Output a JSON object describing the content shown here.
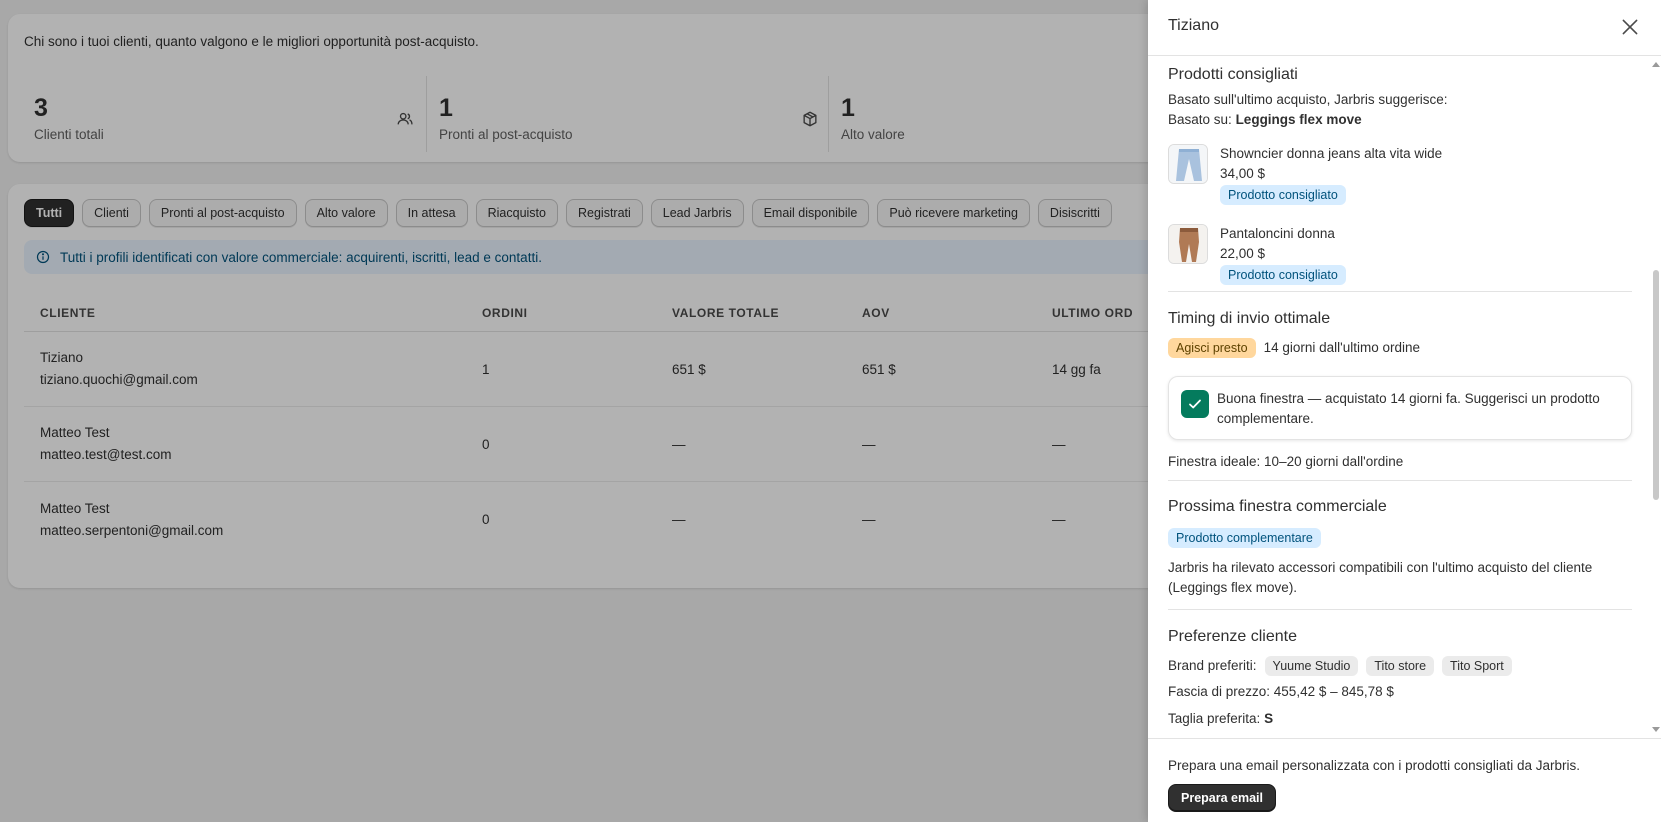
{
  "summary": {
    "intro": "Chi sono i tuoi clienti, quanto valgono e le migliori opportunità post-acquisto.",
    "stats": [
      {
        "value": "3",
        "label": "Clienti totali",
        "icon": "users-icon"
      },
      {
        "value": "1",
        "label": "Pronti al post-acquisto",
        "icon": "package-icon"
      },
      {
        "value": "1",
        "label": "Alto valore",
        "icon": ""
      }
    ]
  },
  "filters": [
    "Tutti",
    "Clienti",
    "Pronti al post-acquisto",
    "Alto valore",
    "In attesa",
    "Riacquisto",
    "Registrati",
    "Lead Jarbris",
    "Email disponibile",
    "Può ricevere marketing",
    "Disiscritti"
  ],
  "banner": "Tutti i profili identificati con valore commerciale: acquirenti, iscritti, lead e contatti.",
  "table": {
    "headers": [
      "CLIENTE",
      "ORDINI",
      "VALORE TOTALE",
      "AOV",
      "ULTIMO ORD"
    ],
    "rows": [
      {
        "name": "Tiziano",
        "email": "tiziano.quochi@gmail.com",
        "orders": "1",
        "total": "651 $",
        "aov": "651 $",
        "last": "14 gg fa"
      },
      {
        "name": "Matteo Test",
        "email": "matteo.test@test.com",
        "orders": "0",
        "total": "—",
        "aov": "—",
        "last": "—"
      },
      {
        "name": "Matteo Test",
        "email": "matteo.serpentoni@gmail.com",
        "orders": "0",
        "total": "—",
        "aov": "—",
        "last": "—"
      }
    ]
  },
  "drawer": {
    "title": "Tiziano",
    "recommended": {
      "heading": "Prodotti consigliati",
      "subtitle": "Basato sull'ultimo acquisto, Jarbris suggerisce:",
      "based_on_label": "Basato su:",
      "based_on_value": "Leggings flex move",
      "products": [
        {
          "name": "Showncier donna jeans alta vita wide",
          "price": "34,00 $",
          "badge": "Prodotto consigliato"
        },
        {
          "name": "Pantaloncini donna",
          "price": "22,00 $",
          "badge": "Prodotto consigliato"
        }
      ]
    },
    "timing": {
      "heading": "Timing di invio ottimale",
      "badge": "Agisci presto",
      "since": "14 giorni dall'ultimo ordine",
      "check_text": "Buona finestra — acquistato 14 giorni fa. Suggerisci un prodotto complementare.",
      "ideal": "Finestra ideale: 10–20 giorni dall'ordine"
    },
    "next_window": {
      "heading": "Prossima finestra commerciale",
      "badge": "Prodotto complementare",
      "text": "Jarbris ha rilevato accessori compatibili con l'ultimo acquisto del cliente (Leggings flex move)."
    },
    "preferences": {
      "heading": "Preferenze cliente",
      "brands_label": "Brand preferiti:",
      "brands": [
        "Yuume Studio",
        "Tito store",
        "Tito Sport"
      ],
      "price_range": "Fascia di prezzo: 455,42 $ – 845,78 $",
      "size_label": "Taglia preferita:",
      "size_value": "S"
    },
    "footer": {
      "text": "Prepara una email personalizzata con i prodotti consigliati da Jarbris.",
      "button": "Prepara email"
    }
  }
}
